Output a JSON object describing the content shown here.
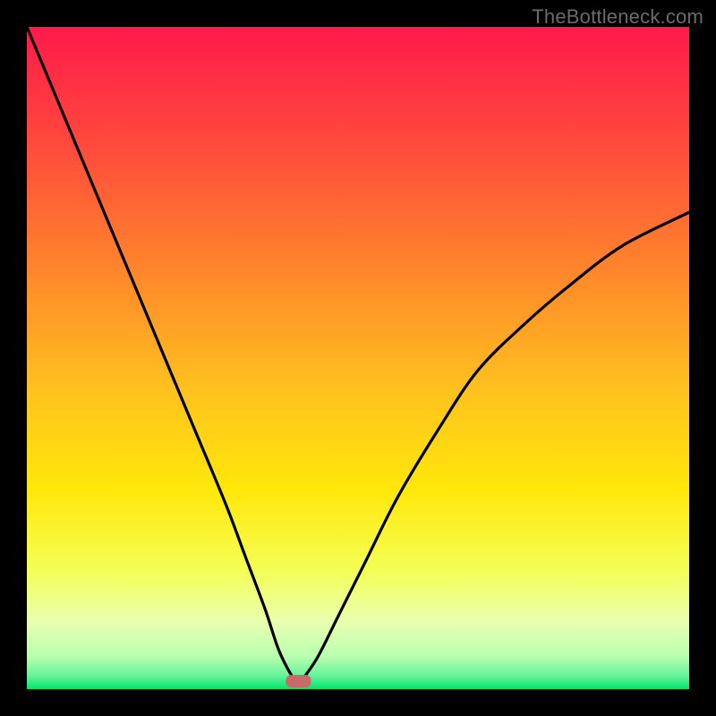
{
  "watermark": "TheBottleneck.com",
  "chart_data": {
    "type": "line",
    "title": "",
    "xlabel": "",
    "ylabel": "",
    "xlim": [
      0,
      100
    ],
    "ylim": [
      0,
      100
    ],
    "background_gradient": {
      "top_color": "#ff1a4b",
      "mid_colors": [
        "#ff6a2f",
        "#ffb020",
        "#ffe600",
        "#f7ff6b"
      ],
      "bottom_color": "#00e56a"
    },
    "marker": {
      "x": 41,
      "y": 1.2,
      "color": "#c76a6a",
      "shape": "rounded-rect"
    },
    "series": [
      {
        "name": "curve",
        "color": "#000000",
        "x": [
          0,
          5,
          10,
          15,
          20,
          25,
          30,
          33,
          36,
          38,
          40,
          41,
          42,
          44,
          47,
          51,
          56,
          62,
          68,
          75,
          82,
          90,
          100
        ],
        "y": [
          100,
          88,
          76,
          64,
          52,
          40,
          28,
          20,
          12,
          6,
          2,
          1,
          2,
          5,
          11,
          19,
          29,
          39,
          48,
          55,
          61,
          67,
          72
        ]
      }
    ]
  }
}
